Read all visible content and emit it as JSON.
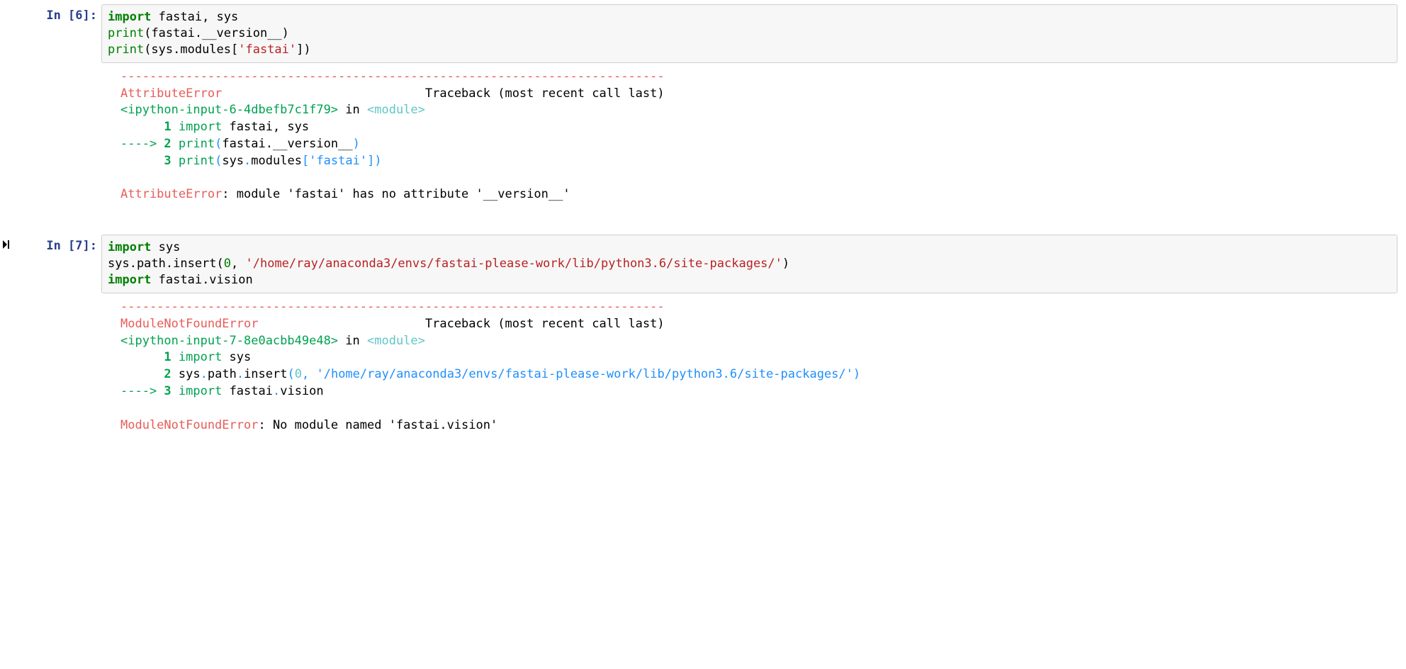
{
  "run_indicator_glyph": "▶|",
  "cell1": {
    "prompt_label": "In [6]:",
    "code": {
      "l1_kw": "import",
      "l1_rest": " fastai, sys",
      "l2_fn": "print",
      "l2_paren_open": "(",
      "l2_rest": "fastai.__version__)",
      "l3_fn": "print",
      "l3_a": "(sys.modules[",
      "l3_str": "'fastai'",
      "l3_b": "])"
    },
    "out": {
      "rule": "---------------------------------------------------------------------------",
      "err_name": "AttributeError",
      "tb_label": "Traceback (most recent call last)",
      "ipy_loc": "<ipython-input-6-4dbefb7c1f79>",
      "in_word": " in ",
      "mod_word": "<module>",
      "l1_pre": "      1",
      "l1_kw": " import",
      "l1_rest": " fastai, sys",
      "l2_arrow": "----> ",
      "l2_num": "2",
      "l2_print": " print",
      "l2_par1": "(",
      "l2_body": "fastai.__version__",
      "l2_par2": ")",
      "l3_pre": "      3",
      "l3_print": " print",
      "l3_a": "(",
      "l3_b": "sys",
      "l3_c": ".",
      "l3_d": "modules",
      "l3_e": "[",
      "l3_str": "'fastai'",
      "l3_f": "]",
      "l3_g": ")",
      "final_err": "AttributeError",
      "final_msg": ": module 'fastai' has no attribute '__version__'"
    }
  },
  "cell2": {
    "prompt_label": "In [7]:",
    "code": {
      "l1_kw": "import",
      "l1_rest": " sys",
      "l2_a": "sys.path.insert(",
      "l2_num": "0",
      "l2_b": ", ",
      "l2_str": "'/home/ray/anaconda3/envs/fastai-please-work/lib/python3.6/site-packages/'",
      "l2_c": ")",
      "l3_kw": "import",
      "l3_rest": " fastai.vision"
    },
    "out": {
      "rule": "---------------------------------------------------------------------------",
      "err_name": "ModuleNotFoundError",
      "tb_label": "Traceback (most recent call last)",
      "ipy_loc": "<ipython-input-7-8e0acbb49e48>",
      "in_word": " in ",
      "mod_word": "<module>",
      "l1_pre": "      1",
      "l1_kw": " import",
      "l1_rest": " sys",
      "l2_pre": "      2",
      "l2_a": " sys",
      "l2_b": ".",
      "l2_c": "path",
      "l2_d": ".",
      "l2_e": "insert",
      "l2_f": "(",
      "l2_num": "0",
      "l2_g": ",",
      "l2_sp": " ",
      "l2_str": "'/home/ray/anaconda3/envs/fastai-please-work/lib/python3.6/site-packages/'",
      "l2_h": ")",
      "l3_arrow": "----> ",
      "l3_num": "3",
      "l3_kw": " import",
      "l3_rest": " fastai",
      "l3_dot": ".",
      "l3_rest2": "vision",
      "final_err": "ModuleNotFoundError",
      "final_msg": ": No module named 'fastai.vision'"
    }
  }
}
